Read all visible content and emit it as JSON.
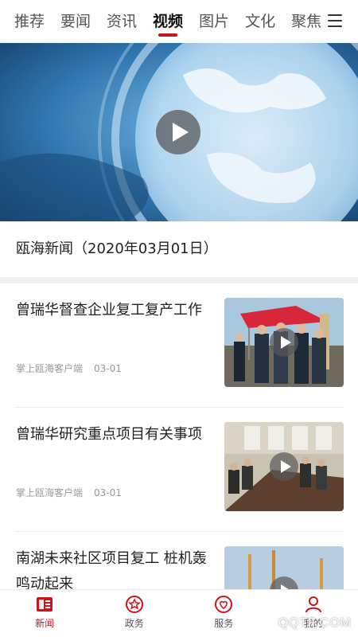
{
  "tabs": [
    {
      "label": "推荐"
    },
    {
      "label": "要闻"
    },
    {
      "label": "资讯"
    },
    {
      "label": "视频"
    },
    {
      "label": "图片"
    },
    {
      "label": "文化"
    },
    {
      "label": "聚焦"
    }
  ],
  "active_tab": "视频",
  "hero": {
    "title": "瓯海新闻（2020年03月01日）"
  },
  "news": [
    {
      "title": "曾瑞华督查企业复工复产工作",
      "source": "掌上瓯海客户端",
      "date": "03-01"
    },
    {
      "title": "曾瑞华研究重点项目有关事项",
      "source": "掌上瓯海客户端",
      "date": "03-01"
    },
    {
      "title": "南湖未来社区项目复工 桩机轰鸣动起来",
      "source": "",
      "date": ""
    }
  ],
  "bottom_nav": [
    {
      "label": "新闻",
      "icon": "news-icon"
    },
    {
      "label": "政务",
      "icon": "government-icon"
    },
    {
      "label": "服务",
      "icon": "service-icon"
    },
    {
      "label": "我的",
      "icon": "profile-icon"
    }
  ],
  "colors": {
    "accent": "#c8161d"
  },
  "watermark": "QQTF.COM"
}
